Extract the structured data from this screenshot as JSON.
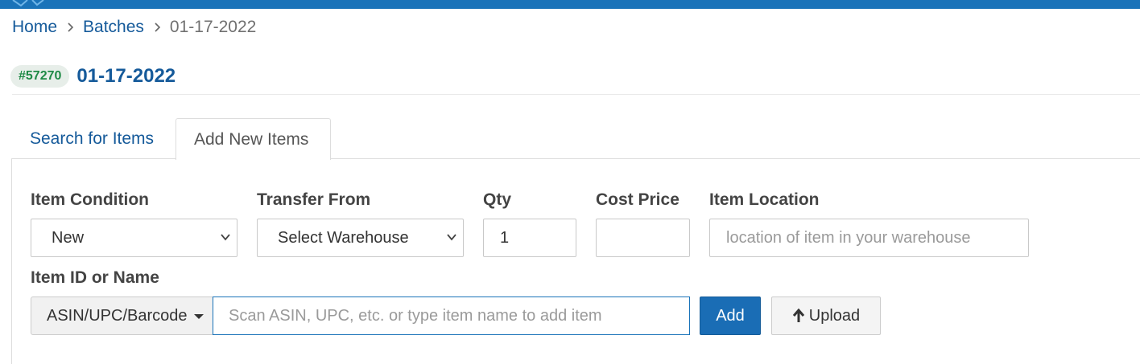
{
  "colors": {
    "brand_blue": "#1a73b9",
    "link_blue": "#155a9a",
    "badge_green": "#1f8a46",
    "badge_bg": "#e7eee9"
  },
  "breadcrumb": {
    "home": "Home",
    "batches": "Batches",
    "current": "01-17-2022",
    "separator_icon": "chevron-right-icon"
  },
  "batch": {
    "id_badge": "#57270",
    "title": "01-17-2022"
  },
  "tabs": [
    {
      "label": "Search for Items",
      "active": false
    },
    {
      "label": "Add New Items",
      "active": true
    }
  ],
  "form": {
    "item_condition": {
      "label": "Item Condition",
      "selected": "New"
    },
    "transfer_from": {
      "label": "Transfer From",
      "selected": "Select Warehouse"
    },
    "qty": {
      "label": "Qty",
      "value": "1"
    },
    "cost_price": {
      "label": "Cost Price",
      "value": ""
    },
    "item_location": {
      "label": "Item Location",
      "placeholder": "location of item in your warehouse"
    },
    "item_id": {
      "label": "Item ID or Name",
      "type_selected": "ASIN/UPC/Barcode",
      "placeholder": "Scan ASIN, UPC, etc. or type item name to add item"
    },
    "add_button": "Add",
    "upload_button": "Upload",
    "upload_icon": "arrow-up-icon"
  }
}
